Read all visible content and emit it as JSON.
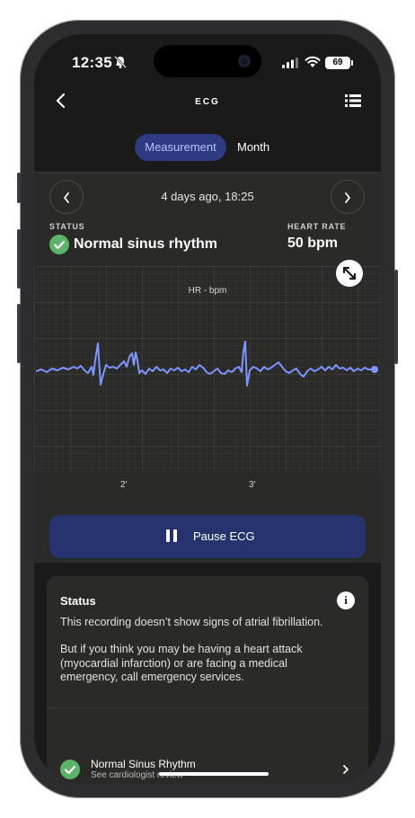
{
  "statusbar": {
    "time": "12:35",
    "battery": "69"
  },
  "nav": {
    "title": "ECG"
  },
  "segments": {
    "measurement": "Measurement",
    "month": "Month"
  },
  "recording": {
    "date": "4 days ago, 18:25",
    "status_label": "STATUS",
    "status_value": "Normal sinus rhythm",
    "heart_rate_label": "HEART RATE",
    "heart_rate_value": "50 bpm"
  },
  "chart_data": {
    "type": "line",
    "title": "HR - bpm",
    "x_tick_labels": [
      "2'",
      "3'"
    ],
    "series": [
      {
        "color": "#7f95ff"
      }
    ],
    "grid": true
  },
  "actions": {
    "pause_label": "Pause ECG"
  },
  "info": {
    "title": "Status",
    "paragraph1": "This recording doesn’t show signs of atrial fibrillation.",
    "paragraph2": "But if you think you may be having a heart attack (myocardial infarction) or are facing a medical emergency, call emergency services.",
    "row_title": "Normal Sinus Rhythm",
    "row_subtitle": "See cardiologist review"
  },
  "colors": {
    "accent": "#2e3b80",
    "success": "#5cb36a",
    "trace": "#7f95ff"
  }
}
